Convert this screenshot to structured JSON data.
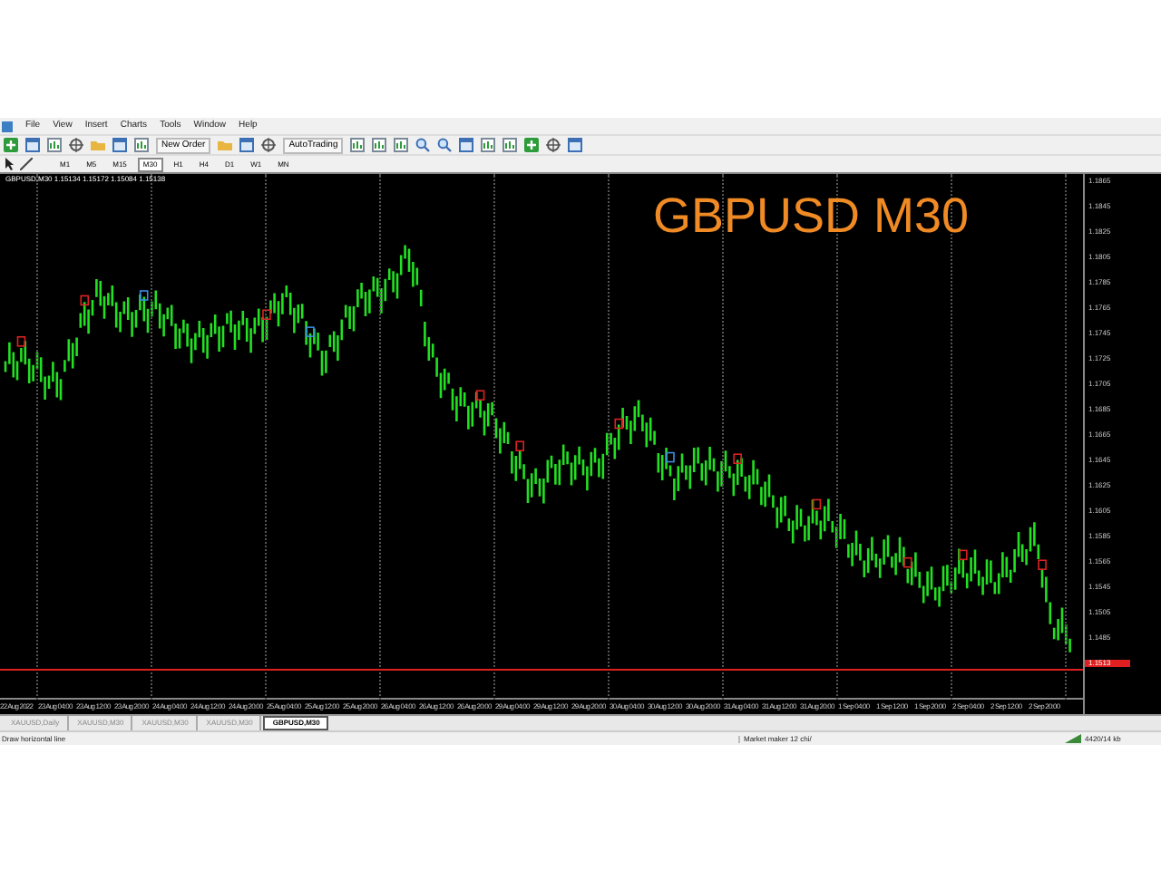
{
  "menu": [
    "File",
    "View",
    "Insert",
    "Charts",
    "Tools",
    "Window",
    "Help"
  ],
  "toolbar": {
    "buttons": [
      {
        "kind": "icon"
      },
      {
        "kind": "icon"
      },
      {
        "kind": "icon"
      },
      {
        "kind": "icon"
      },
      {
        "kind": "icon"
      },
      {
        "kind": "icon"
      },
      {
        "kind": "icon"
      },
      {
        "kind": "text",
        "label": "New Order"
      },
      {
        "kind": "icon"
      },
      {
        "kind": "icon"
      },
      {
        "kind": "icon"
      },
      {
        "kind": "text",
        "label": "AutoTrading"
      },
      {
        "kind": "icon"
      },
      {
        "kind": "icon"
      },
      {
        "kind": "icon"
      },
      {
        "kind": "icon"
      },
      {
        "kind": "icon"
      },
      {
        "kind": "icon"
      },
      {
        "kind": "icon"
      },
      {
        "kind": "icon"
      },
      {
        "kind": "icon"
      },
      {
        "kind": "icon"
      },
      {
        "kind": "icon"
      }
    ]
  },
  "timeframes": [
    {
      "label": "M1",
      "selected": false
    },
    {
      "label": "M5",
      "selected": false
    },
    {
      "label": "M15",
      "selected": false
    },
    {
      "label": "M30",
      "selected": true
    },
    {
      "label": "H1",
      "selected": false
    },
    {
      "label": "H4",
      "selected": false
    },
    {
      "label": "D1",
      "selected": false
    },
    {
      "label": "W1",
      "selected": false
    },
    {
      "label": "MN",
      "selected": false
    }
  ],
  "chart": {
    "info": "GBPUSD,M30  1.15134 1.15172 1.15084 1.15138",
    "overlay_title": "GBPUSD M30",
    "current_price": "1.1513",
    "price_labels": [
      "1.1865",
      "1.1845",
      "1.1825",
      "1.1805",
      "1.1785",
      "1.1765",
      "1.1745",
      "1.1725",
      "1.1705",
      "1.1685",
      "1.1665",
      "1.1645",
      "1.1625",
      "1.1605",
      "1.1585",
      "1.1565",
      "1.1545",
      "1.1505",
      "1.1485"
    ],
    "time_labels": [
      "22 Aug 2022",
      "23 Aug 04:00",
      "23 Aug 12:00",
      "23 Aug 20:00",
      "24 Aug 04:00",
      "24 Aug 12:00",
      "24 Aug 20:00",
      "25 Aug 04:00",
      "25 Aug 12:00",
      "25 Aug 20:00",
      "26 Aug 04:00",
      "26 Aug 12:00",
      "26 Aug 20:00",
      "29 Aug 04:00",
      "29 Aug 12:00",
      "29 Aug 20:00",
      "30 Aug 04:00",
      "30 Aug 12:00",
      "30 Aug 20:00",
      "31 Aug 04:00",
      "31 Aug 12:00",
      "31 Aug 20:00",
      "1 Sep 04:00",
      "1 Sep 12:00",
      "1 Sep 20:00",
      "2 Sep 04:00",
      "2 Sep 12:00",
      "2 Sep 20:00"
    ]
  },
  "tabs": [
    {
      "label": "XAUUSD,Daily",
      "selected": false
    },
    {
      "label": "XAUUSD,M30",
      "selected": false
    },
    {
      "label": "XAUUSD,M30",
      "selected": false
    },
    {
      "label": "XAUUSD,M30",
      "selected": false
    },
    {
      "label": "GBPUSD,M30",
      "selected": true
    }
  ],
  "status_bar": {
    "hint": "Draw horizontal line",
    "profile": "Market maker 12 chi/",
    "traffic": "4420/14 kb"
  }
}
